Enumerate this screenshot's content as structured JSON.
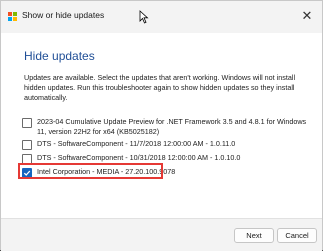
{
  "window": {
    "title": "Show or hide updates"
  },
  "page": {
    "heading": "Hide updates",
    "description": "Updates are available. Select the updates that aren't working. Windows will not install hidden updates. Run this troubleshooter again to show hidden updates so they install automatically."
  },
  "updates": [
    {
      "label": "2023-04 Cumulative Update Preview for .NET Framework 3.5 and 4.8.1 for Windows 11, version 22H2 for x64 (KB5025182)",
      "checked": false
    },
    {
      "label": "DTS - SoftwareComponent - 11/7/2018 12:00:00 AM - 1.0.11.0",
      "checked": false
    },
    {
      "label": "DTS - SoftwareComponent - 10/31/2018 12:00:00 AM - 1.0.10.0",
      "checked": false
    },
    {
      "label": "Intel Corporation - MEDIA - 27.20.100.9078",
      "checked": true
    }
  ],
  "footer": {
    "next_label": "Next",
    "cancel_label": "Cancel"
  },
  "icons": {
    "close": "close-icon",
    "logo": "windows-logo-icon",
    "check": "checkmark-icon"
  },
  "colors": {
    "heading": "#1f4e96",
    "checkbox_checked": "#1565c0",
    "highlight": "#e53935"
  }
}
